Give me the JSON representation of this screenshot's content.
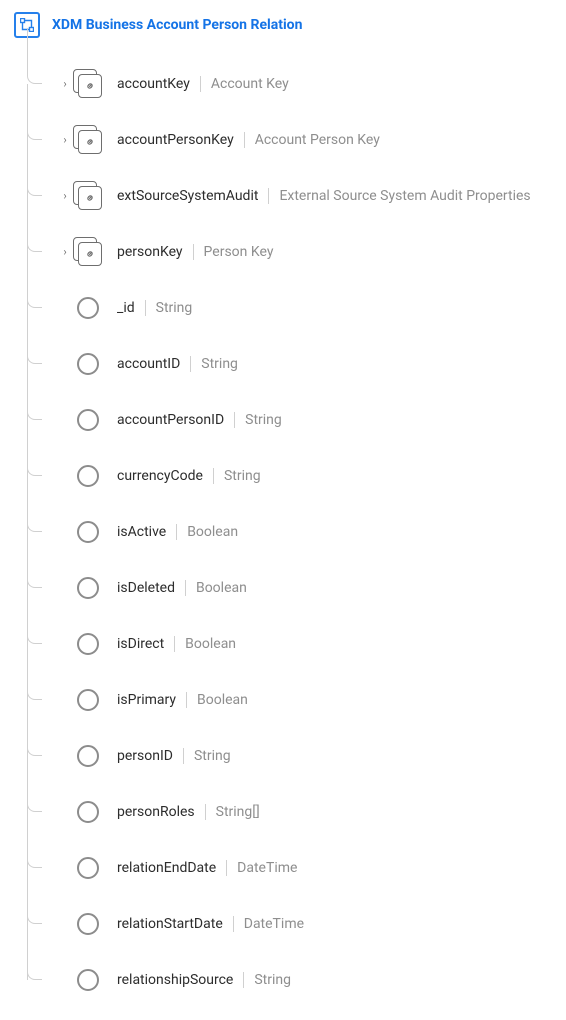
{
  "schema": {
    "title": "XDM Business Account Person Relation",
    "fields": [
      {
        "name": "accountKey",
        "type": "Account Key",
        "kind": "object",
        "expandable": true
      },
      {
        "name": "accountPersonKey",
        "type": "Account Person Key",
        "kind": "object",
        "expandable": true
      },
      {
        "name": "extSourceSystemAudit",
        "type": "External Source System Audit Properties",
        "kind": "object",
        "expandable": true
      },
      {
        "name": "personKey",
        "type": "Person Key",
        "kind": "object",
        "expandable": true
      },
      {
        "name": "_id",
        "type": "String",
        "kind": "leaf",
        "expandable": false
      },
      {
        "name": "accountID",
        "type": "String",
        "kind": "leaf",
        "expandable": false
      },
      {
        "name": "accountPersonID",
        "type": "String",
        "kind": "leaf",
        "expandable": false
      },
      {
        "name": "currencyCode",
        "type": "String",
        "kind": "leaf",
        "expandable": false
      },
      {
        "name": "isActive",
        "type": "Boolean",
        "kind": "leaf",
        "expandable": false
      },
      {
        "name": "isDeleted",
        "type": "Boolean",
        "kind": "leaf",
        "expandable": false
      },
      {
        "name": "isDirect",
        "type": "Boolean",
        "kind": "leaf",
        "expandable": false
      },
      {
        "name": "isPrimary",
        "type": "Boolean",
        "kind": "leaf",
        "expandable": false
      },
      {
        "name": "personID",
        "type": "String",
        "kind": "leaf",
        "expandable": false
      },
      {
        "name": "personRoles",
        "type": "String[]",
        "kind": "leaf",
        "expandable": false
      },
      {
        "name": "relationEndDate",
        "type": "DateTime",
        "kind": "leaf",
        "expandable": false
      },
      {
        "name": "relationStartDate",
        "type": "DateTime",
        "kind": "leaf",
        "expandable": false
      },
      {
        "name": "relationshipSource",
        "type": "String",
        "kind": "leaf",
        "expandable": false
      }
    ]
  },
  "icons": {
    "chevron": "›"
  }
}
